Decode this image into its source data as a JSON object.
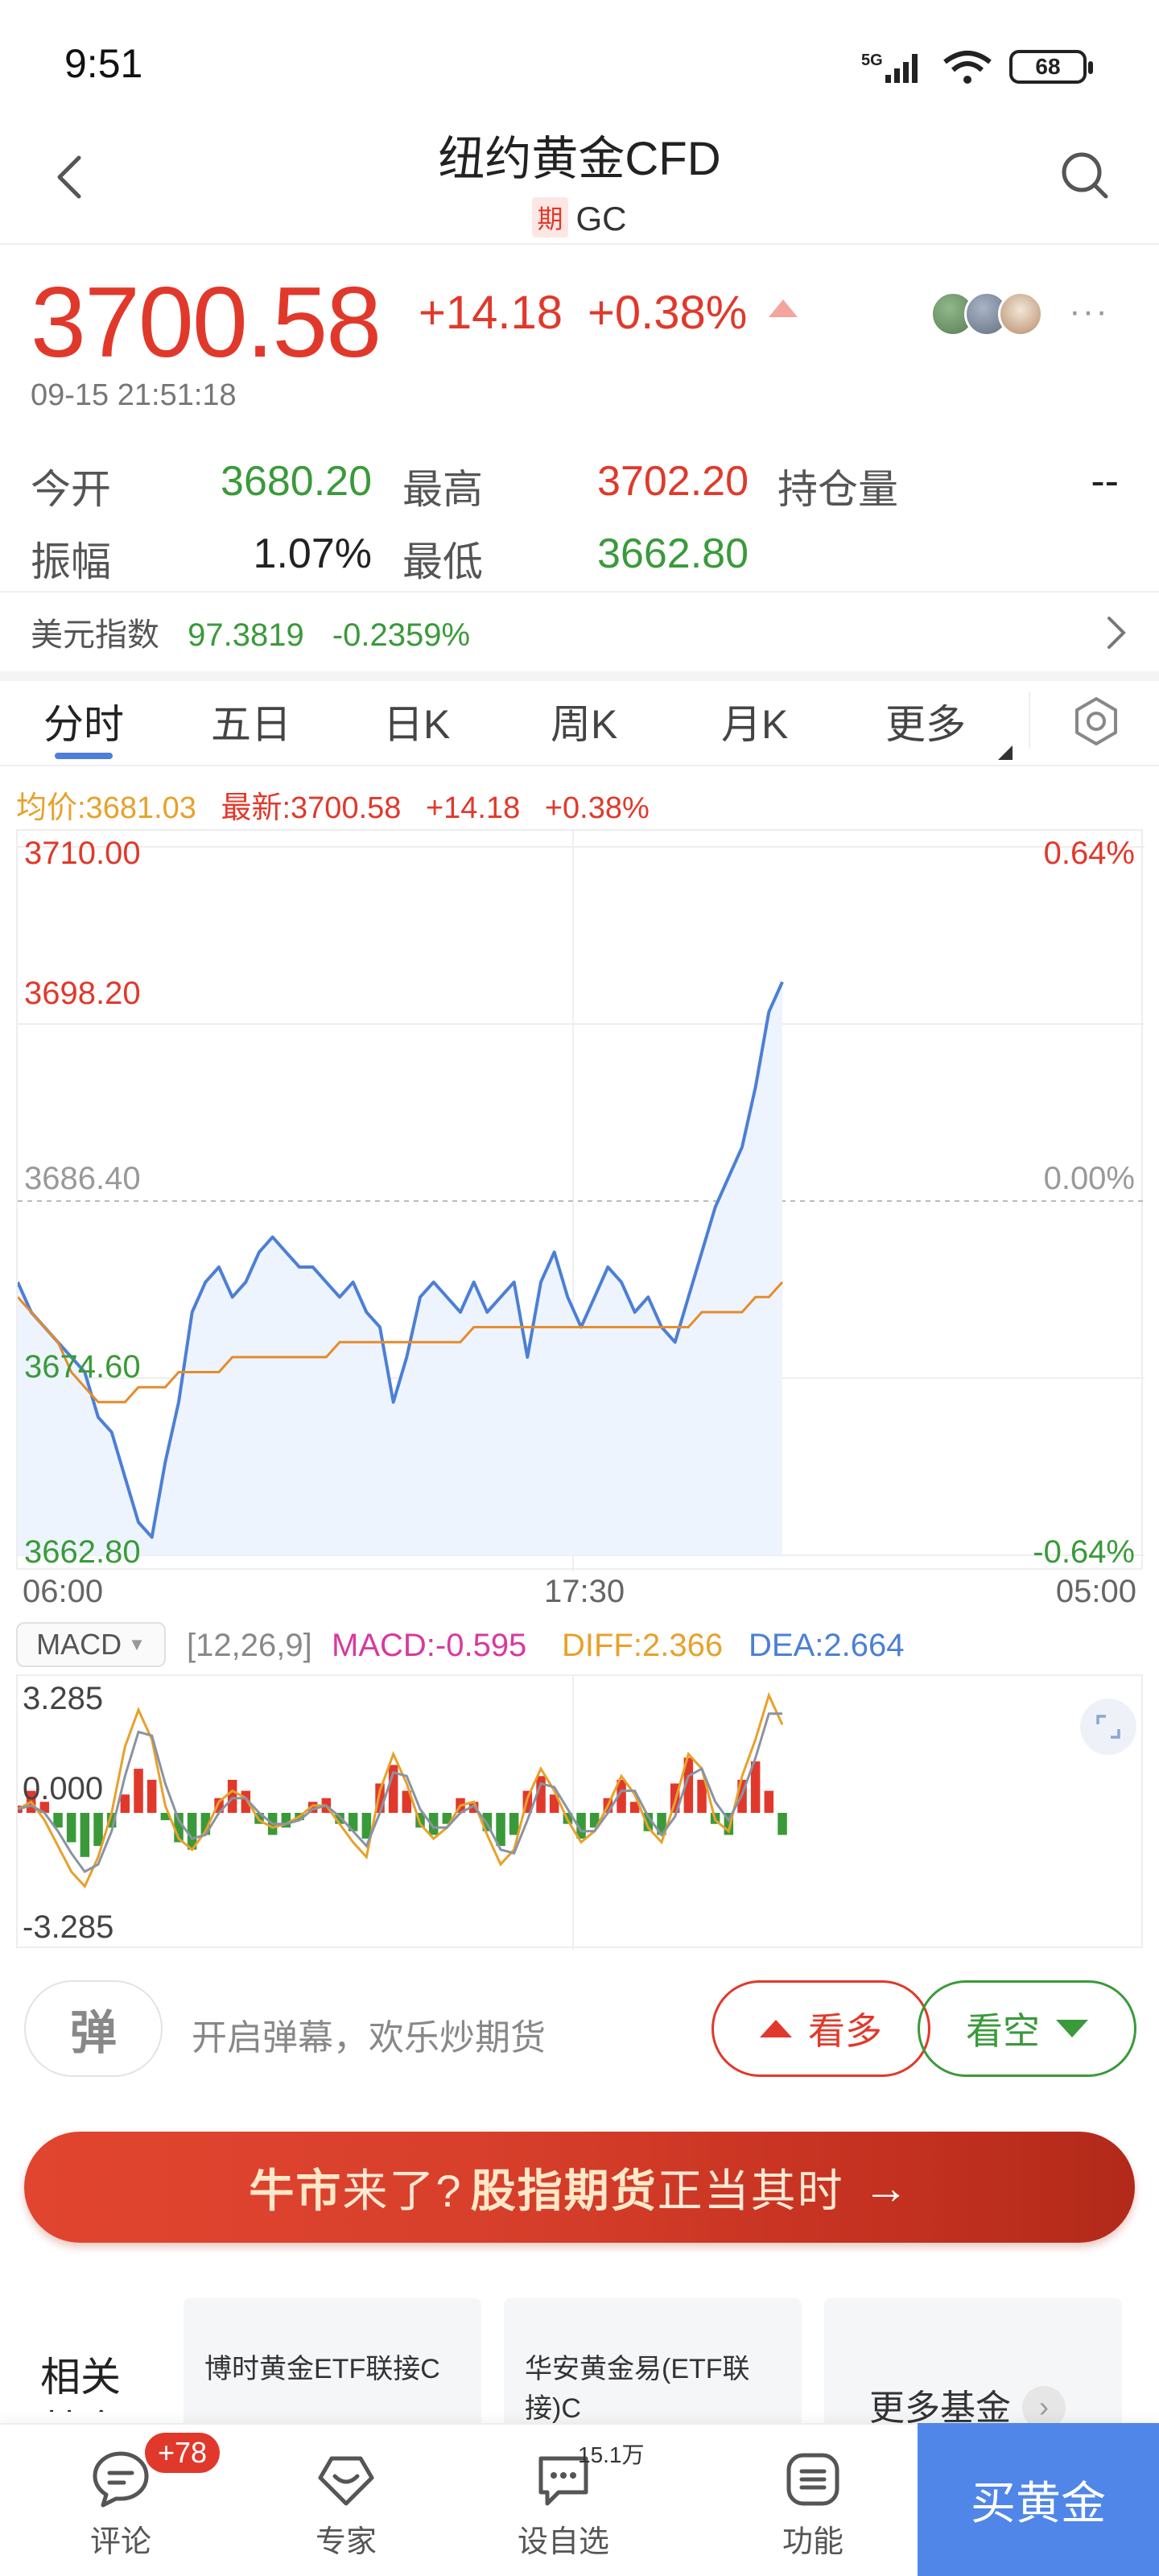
{
  "status_bar": {
    "time": "9:51",
    "network": "5G",
    "battery": "68"
  },
  "header": {
    "title": "纽约黄金CFD",
    "tag": "期",
    "code": "GC"
  },
  "quote": {
    "price": "3700.58",
    "change": "+14.18",
    "change_pct": "+0.38%",
    "timestamp": "09-15 21:51:18",
    "more": "···"
  },
  "stats": {
    "open_label": "今开",
    "open": "3680.20",
    "high_label": "最高",
    "high": "3702.20",
    "oi_label": "持仓量",
    "oi": "--",
    "amp_label": "振幅",
    "amp": "1.07%",
    "low_label": "最低",
    "low": "3662.80"
  },
  "usd_index": {
    "label": "美元指数",
    "value": "97.3819",
    "change": "-0.2359%"
  },
  "tabs": [
    {
      "label": "分时",
      "active": true
    },
    {
      "label": "五日"
    },
    {
      "label": "日K"
    },
    {
      "label": "周K"
    },
    {
      "label": "月K"
    },
    {
      "label": "更多"
    }
  ],
  "chart_legend": {
    "avg": "均价:3681.03",
    "latest": "最新:3700.58",
    "change": "+14.18",
    "pct": "+0.38%"
  },
  "chart_data": [
    {
      "type": "line",
      "y_labels_left": [
        "3710.00",
        "3698.20",
        "3686.40",
        "3674.60",
        "3662.80"
      ],
      "y_labels_right": [
        "0.64%",
        "0.00%",
        "-0.64%"
      ],
      "x_labels": [
        "06:00",
        "17:30",
        "05:00"
      ],
      "ylim": [
        3662.8,
        3710.0
      ],
      "reference": 3686.4,
      "series": [
        {
          "name": "最新",
          "color": "#4c7fd6",
          "values": [
            3681,
            3679,
            3678,
            3677,
            3676,
            3675,
            3672,
            3671,
            3668,
            3665,
            3664,
            3669,
            3673,
            3679,
            3681,
            3682,
            3680,
            3681,
            3683,
            3684,
            3683,
            3682,
            3682,
            3681,
            3680,
            3681,
            3679,
            3678,
            3673,
            3676,
            3680,
            3681,
            3680,
            3679,
            3681,
            3679,
            3680,
            3681,
            3676,
            3681,
            3683,
            3680,
            3678,
            3680,
            3682,
            3681,
            3679,
            3680,
            3678,
            3677,
            3680,
            3683,
            3686,
            3688,
            3690,
            3694,
            3699,
            3701
          ]
        },
        {
          "name": "均价",
          "color": "#e58b2c",
          "values": [
            3680,
            3679,
            3678,
            3677,
            3675,
            3674,
            3673,
            3673,
            3673,
            3674,
            3674,
            3674,
            3675,
            3675,
            3675,
            3675,
            3676,
            3676,
            3676,
            3676,
            3676,
            3676,
            3676,
            3676,
            3677,
            3677,
            3677,
            3677,
            3677,
            3677,
            3677,
            3677,
            3677,
            3677,
            3678,
            3678,
            3678,
            3678,
            3678,
            3678,
            3678,
            3678,
            3678,
            3678,
            3678,
            3678,
            3678,
            3678,
            3678,
            3678,
            3678,
            3679,
            3679,
            3679,
            3679,
            3680,
            3680,
            3681
          ]
        }
      ]
    },
    {
      "type": "bar",
      "name": "MACD",
      "y_labels": [
        "3.285",
        "0.000",
        "-3.285"
      ],
      "ylim": [
        -3.285,
        3.285
      ],
      "params": "[12,26,9]",
      "macd_label": "MACD:-0.595",
      "diff_label": "DIFF:2.366",
      "dea_label": "DEA:2.664",
      "series": [
        {
          "name": "MACD",
          "values": [
            0.2,
            0.6,
            0.3,
            -0.4,
            -0.8,
            -1.2,
            -0.9,
            -0.4,
            0.5,
            1.2,
            0.9,
            -0.2,
            -0.8,
            -1.0,
            -0.6,
            0.4,
            0.9,
            0.6,
            -0.3,
            -0.6,
            -0.4,
            -0.2,
            0.3,
            0.4,
            -0.3,
            -0.5,
            -0.7,
            0.8,
            1.3,
            0.6,
            -0.4,
            -0.6,
            -0.3,
            0.4,
            0.3,
            -0.5,
            -0.9,
            -0.6,
            0.6,
            1.0,
            0.5,
            -0.3,
            -0.7,
            -0.4,
            0.4,
            0.9,
            0.3,
            -0.5,
            -0.6,
            0.8,
            1.5,
            0.9,
            -0.3,
            -0.6,
            0.9,
            1.4,
            0.6,
            -0.6
          ]
        },
        {
          "name": "DIFF",
          "values": [
            0.1,
            0.3,
            -0.2,
            -0.9,
            -1.6,
            -2.0,
            -1.2,
            0.0,
            1.8,
            2.8,
            2.0,
            0.2,
            -0.7,
            -1.0,
            -0.5,
            0.3,
            0.6,
            0.4,
            -0.2,
            -0.4,
            -0.3,
            -0.1,
            0.2,
            0.2,
            -0.3,
            -0.8,
            -1.2,
            0.6,
            1.6,
            0.8,
            -0.3,
            -0.7,
            -0.4,
            0.2,
            0.3,
            -0.6,
            -1.4,
            -1.0,
            0.4,
            1.2,
            0.6,
            -0.2,
            -0.8,
            -0.5,
            0.2,
            1.0,
            0.5,
            -0.4,
            -0.8,
            0.3,
            1.6,
            1.2,
            -0.2,
            -0.5,
            1.0,
            2.0,
            3.2,
            2.4
          ]
        },
        {
          "name": "DEA",
          "values": [
            0.1,
            0.2,
            0.0,
            -0.5,
            -1.1,
            -1.6,
            -1.4,
            -0.5,
            1.0,
            2.2,
            2.1,
            0.8,
            -0.2,
            -0.7,
            -0.6,
            0.0,
            0.4,
            0.4,
            0.0,
            -0.3,
            -0.3,
            -0.2,
            0.1,
            0.2,
            -0.1,
            -0.5,
            -0.9,
            0.0,
            1.1,
            1.0,
            0.1,
            -0.4,
            -0.4,
            0.0,
            0.2,
            -0.3,
            -1.0,
            -1.1,
            -0.2,
            0.8,
            0.7,
            0.1,
            -0.5,
            -0.5,
            0.0,
            0.6,
            0.6,
            -0.1,
            -0.6,
            -0.1,
            1.0,
            1.2,
            0.3,
            -0.2,
            0.5,
            1.5,
            2.7,
            2.7
          ]
        }
      ]
    }
  ],
  "danmu": {
    "button": "弹",
    "placeholder": "开启弹幕，欢乐炒期货",
    "bull": "看多",
    "bear": "看空"
  },
  "banner": {
    "part1": "牛市",
    "part2": "来了?",
    "part3": "股指期货",
    "part4": "正当其时",
    "arrow": "→"
  },
  "related": {
    "title": "相关基金",
    "funds": [
      "博时黄金ETF联接C",
      "华安黄金易(ETF联接)C"
    ],
    "more": "更多基金"
  },
  "bottom_nav": {
    "comment": "评论",
    "comment_badge": "+78",
    "expert": "专家",
    "fav": "设自选",
    "fav_count": "15.1万",
    "function": "功能",
    "buy": "买黄金"
  },
  "colors": {
    "up": "#e0392b",
    "down": "#3a9a3a",
    "accent": "#4c7fd6",
    "avg": "#e58b2c"
  }
}
